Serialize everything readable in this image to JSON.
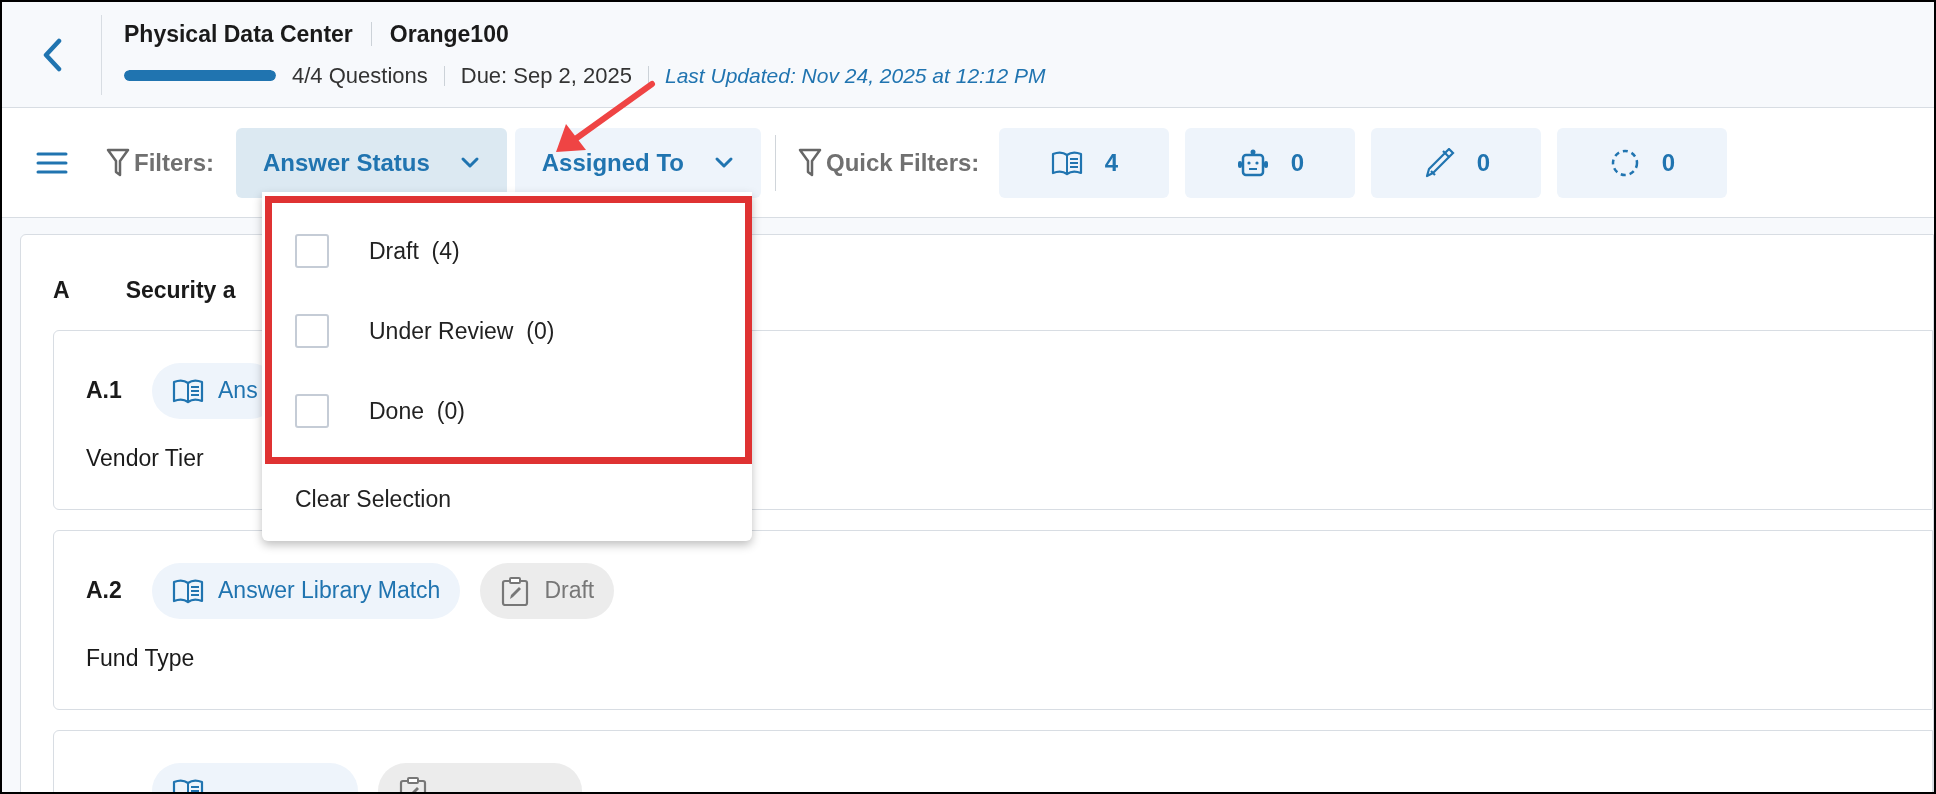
{
  "header": {
    "title": "Physical Data Center",
    "subtitle": "Orange100",
    "progress": {
      "level": 1.0
    },
    "questions": "4/4 Questions",
    "due": "Due: Sep 2, 2025",
    "last_updated": "Last Updated: Nov 24, 2025 at 12:12 PM"
  },
  "toolbar": {
    "filters_label": "Filters:",
    "filters": [
      {
        "label": "Answer Status",
        "selected": true
      },
      {
        "label": "Assigned To",
        "selected": false
      }
    ],
    "quick_filters_label": "Quick Filters:",
    "quick_filters": [
      {
        "kind": "library",
        "count": "4"
      },
      {
        "kind": "robot",
        "count": "0"
      },
      {
        "kind": "pen",
        "count": "0"
      },
      {
        "kind": "pending",
        "count": "0"
      }
    ]
  },
  "dropdown": {
    "options": [
      {
        "label": "Draft",
        "count": "(4)",
        "checked": false
      },
      {
        "label": "Under Review",
        "count": "(0)",
        "checked": false
      },
      {
        "label": "Done",
        "count": "(0)",
        "checked": false
      }
    ],
    "clear": "Clear Selection"
  },
  "section": {
    "letter": "A",
    "title": "Security a",
    "questions": [
      {
        "number": "A.1",
        "tags": [
          {
            "kind": "library",
            "label": "Ans"
          }
        ],
        "text": "Vendor Tier"
      },
      {
        "number": "A.2",
        "tags": [
          {
            "kind": "library",
            "label": "Answer Library Match"
          },
          {
            "kind": "status",
            "label": "Draft"
          }
        ],
        "text": "Fund Type"
      },
      {
        "tags": [
          {
            "kind": "library"
          },
          {
            "kind": "status"
          }
        ]
      }
    ]
  }
}
